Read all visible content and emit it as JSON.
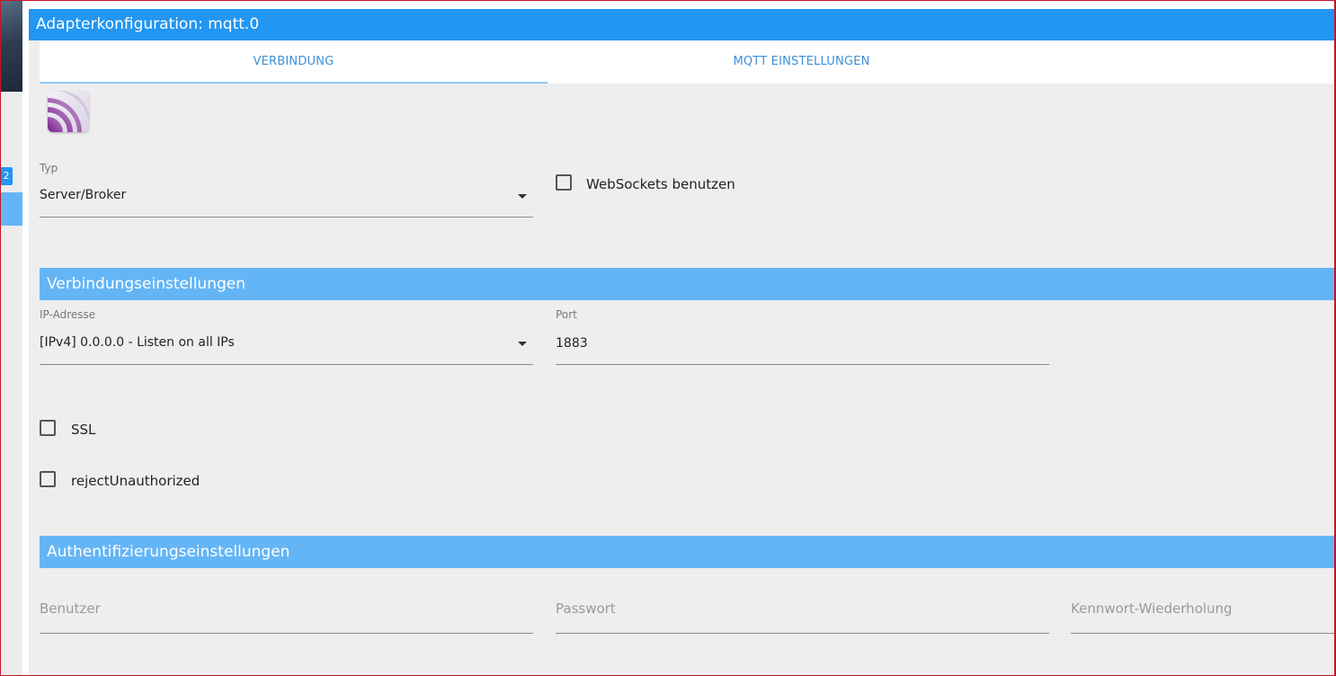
{
  "sidebar": {
    "badge": "2"
  },
  "dialog": {
    "title": "Adapterkonfiguration: mqtt.0",
    "tabs": [
      {
        "label": "VERBINDUNG",
        "active": true
      },
      {
        "label": "MQTT EINSTELLUNGEN",
        "active": false
      }
    ]
  },
  "general": {
    "type_label": "Typ",
    "type_value": "Server/Broker",
    "websockets_label": "WebSockets benutzen",
    "websockets_checked": false
  },
  "connection": {
    "section_title": "Verbindungseinstellungen",
    "ip_label": "IP-Adresse",
    "ip_value": "[IPv4] 0.0.0.0 - Listen on all IPs",
    "port_label": "Port",
    "port_value": "1883",
    "ssl_label": "SSL",
    "ssl_checked": false,
    "reject_label": "rejectUnauthorized",
    "reject_checked": false
  },
  "auth": {
    "section_title": "Authentifizierungseinstellungen",
    "user_placeholder": "Benutzer",
    "password_placeholder": "Passwort",
    "password_repeat_placeholder": "Kennwort-Wiederholung"
  },
  "colors": {
    "title_bar": "#2196f3",
    "section_bar": "#64b5f6",
    "tab_text": "#3b8fd9",
    "tab_indicator": "#90caf9",
    "background": "#eeeeee"
  },
  "icons": {
    "logo": "mqtt-logo-icon",
    "dropdown": "caret-down-icon"
  }
}
